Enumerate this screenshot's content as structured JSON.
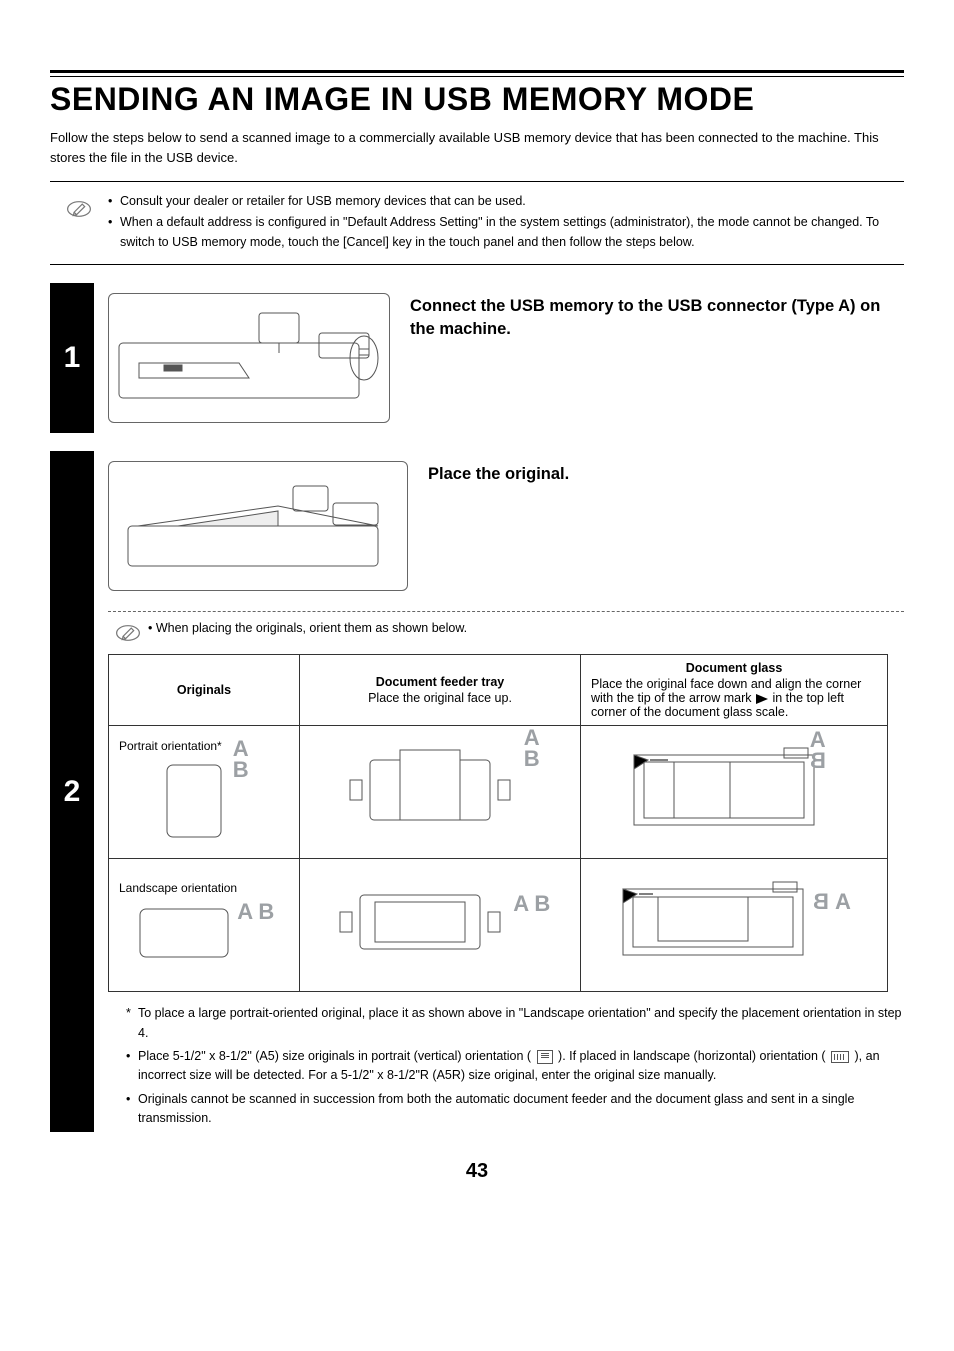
{
  "title": "SENDING AN IMAGE IN USB MEMORY MODE",
  "intro": "Follow the steps below to send a scanned image to a commercially available USB memory device that has been connected to the machine. This stores the file in the USB device.",
  "top_notes": [
    "Consult your dealer or retailer for USB memory devices that can be used.",
    "When a default address is configured in \"Default Address Setting\" in the system settings (administrator), the mode cannot be changed. To switch to USB memory mode, touch the [Cancel] key in the touch panel and then follow the steps below."
  ],
  "steps": {
    "s1": {
      "num": "1",
      "heading": "Connect the USB memory to the USB connector (Type A) on the machine."
    },
    "s2": {
      "num": "2",
      "heading": "Place the original.",
      "sub_note": "When placing the originals, orient them as shown below.",
      "table": {
        "h_originals": "Originals",
        "h_feeder_title": "Document feeder tray",
        "h_feeder_sub": "Place the original face up.",
        "h_glass_title": "Document glass",
        "h_glass_body_a": "Place the original face down and align the corner with the tip of the arrow mark ",
        "h_glass_body_b": " in the top left corner of the document glass scale.",
        "row1_label": "Portrait orientation*",
        "row2_label": "Landscape orientation"
      },
      "footnotes": {
        "f1": "To place a large portrait-oriented original, place it as shown above in \"Landscape orientation\" and specify the placement orientation in step 4.",
        "f2a": "Place 5-1/2\" x 8-1/2\" (A5) size originals in portrait (vertical) orientation (",
        "f2b": "). If placed in landscape (horizontal) orientation (",
        "f2c": "), an incorrect size will be detected. For a 5-1/2\" x 8-1/2\"R (A5R) size original, enter the original size manually.",
        "f3": "Originals cannot be scanned in succession from both the automatic document feeder and the document glass and sent in a single transmission."
      }
    }
  },
  "page_number": "43"
}
